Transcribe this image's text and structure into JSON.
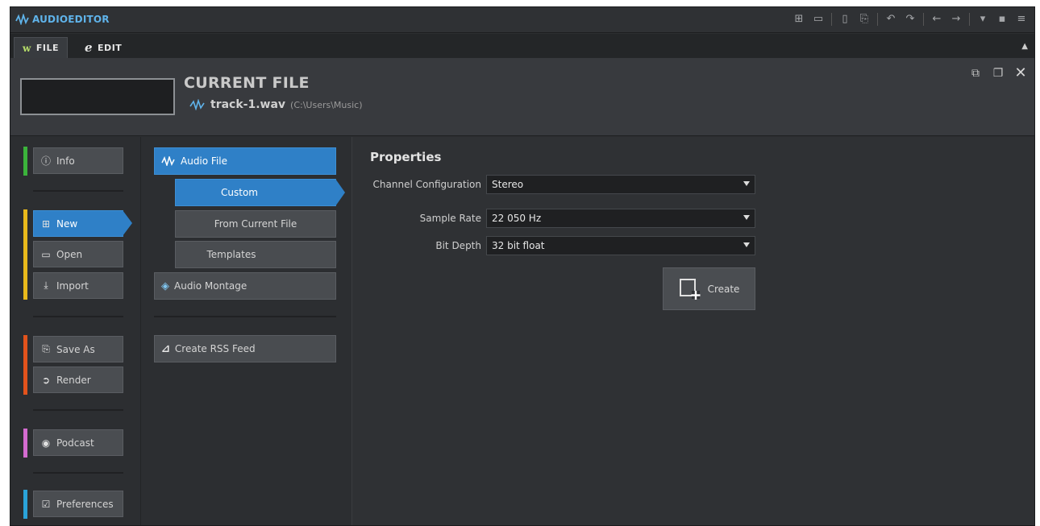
{
  "app": {
    "title": "AUDIOEDITOR"
  },
  "tabs": [
    {
      "label": "FILE",
      "glyph": "w"
    },
    {
      "label": "EDIT",
      "glyph": "e"
    }
  ],
  "header": {
    "title": "CURRENT FILE",
    "file_name": "track-1.wav",
    "file_path": "(C:\\Users\\Music)"
  },
  "sidebar": {
    "items": [
      {
        "label": "Info",
        "icon": "info-icon"
      },
      {
        "label": "New",
        "icon": "new-file-icon"
      },
      {
        "label": "Open",
        "icon": "folder-open-icon"
      },
      {
        "label": "Import",
        "icon": "import-icon"
      },
      {
        "label": "Save As",
        "icon": "save-as-icon"
      },
      {
        "label": "Render",
        "icon": "render-icon"
      },
      {
        "label": "Podcast",
        "icon": "podcast-icon"
      },
      {
        "label": "Preferences",
        "icon": "preferences-icon"
      }
    ],
    "strip_colors": {
      "info": "#3bb33b",
      "file": "#e9b91b",
      "save": "#e2531c",
      "podcast": "#d46bd0",
      "prefs": "#2aa3d9"
    }
  },
  "middle": {
    "items": [
      {
        "label": "Audio File"
      },
      {
        "label": "Custom"
      },
      {
        "label": "From Current File"
      },
      {
        "label": "Templates"
      },
      {
        "label": "Audio Montage"
      },
      {
        "label": "Create RSS Feed"
      }
    ]
  },
  "properties": {
    "title": "Properties",
    "channel_label": "Channel Configuration",
    "channel_value": "Stereo",
    "sample_rate_label": "Sample Rate",
    "sample_rate_value": "22 050 Hz",
    "bit_depth_label": "Bit Depth",
    "bit_depth_value": "32 bit float",
    "create_label": "Create"
  },
  "colors": {
    "accent": "#2f80c7",
    "brand": "#5fb3ea"
  }
}
